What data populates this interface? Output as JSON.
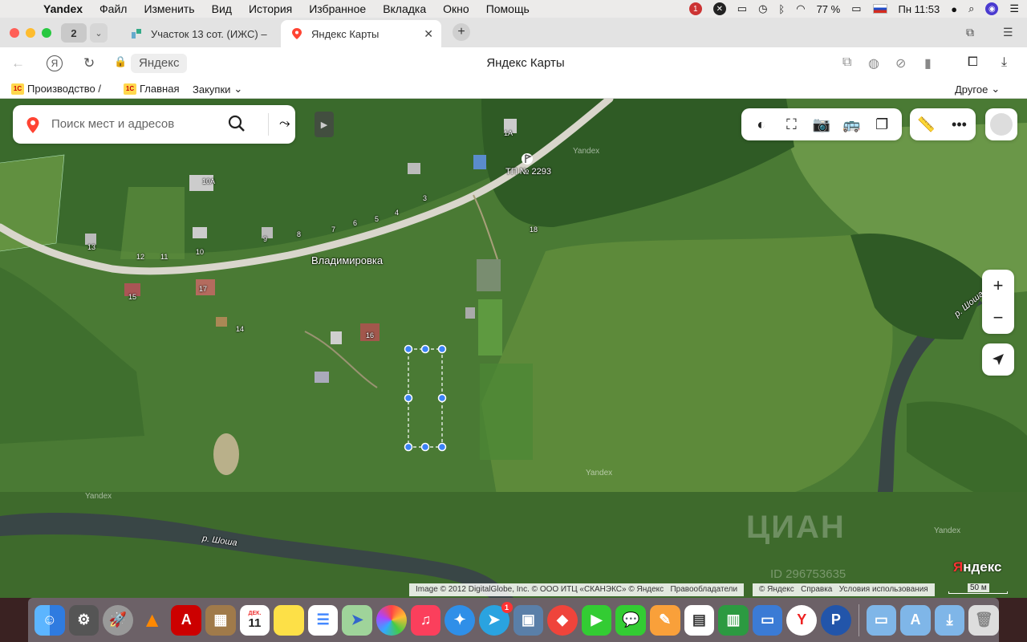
{
  "menubar": {
    "app_name": "Yandex",
    "items": [
      "Файл",
      "Изменить",
      "Вид",
      "История",
      "Избранное",
      "Вкладка",
      "Окно",
      "Помощь"
    ],
    "battery": "77 %",
    "clock": "Пн 11:53"
  },
  "tabs": {
    "count": "2",
    "inactive_title": "Участок 13 сот. (ИЖС) –",
    "active_title": "Яндекс Карты",
    "close": "✕",
    "new": "+"
  },
  "address": {
    "url": "Яндекс",
    "page_title": "Яндекс Карты"
  },
  "bookmarks": {
    "items": [
      {
        "label": "Производство /",
        "icon": "1c-icon"
      },
      {
        "label": "Главная",
        "icon": "1c-icon"
      },
      {
        "label": "Закупки",
        "icon": "none"
      }
    ],
    "other": "Другое"
  },
  "map": {
    "search_placeholder": "Поиск мест и адресов",
    "village": "Владимировка",
    "substation": "ТП № 2293",
    "river1": "р. Шоша",
    "river2": "р. Шоша",
    "house_numbers": [
      "10А",
      "1А",
      "3",
      "5",
      "4",
      "6",
      "7",
      "8",
      "9",
      "10",
      "11",
      "12",
      "13",
      "14",
      "15",
      "16",
      "18",
      "17"
    ],
    "watermark": "Yandex",
    "attribution": "Image © 2012 DigitalGlobe, Inc. © ООО ИТЦ «СКАНЭКС» © Яндекс",
    "rights_holders": "Правообладатели",
    "attribution2_copy": "© Яндекс",
    "help": "Справка",
    "terms": "Условия использования",
    "logo_red": "Я",
    "logo_rest": "ндекс",
    "scale": "50 м",
    "cian": "ЦИАН",
    "cian_id": "ID 296753635",
    "zoom_in": "+",
    "zoom_out": "−"
  },
  "colors": {
    "field_light": "#6e9a3f",
    "field_dark": "#3f6b2b",
    "river": "#3a4a4a",
    "road": "#d9d6cc",
    "marker": "#3b82f6",
    "yandex_red": "#f33"
  },
  "dock": {
    "apps": [
      "finder-icon",
      "preferences-icon",
      "launchpad-icon",
      "vlc-icon",
      "acrobat-icon",
      "notes-icon",
      "calendar-icon",
      "stickies-icon",
      "reminders-icon",
      "maps-icon",
      "photos-icon",
      "music-icon",
      "safari-icon",
      "telegram-icon",
      "preview-icon",
      "anydesk-icon",
      "facetime-icon",
      "messages-icon",
      "pages-icon",
      "numbers-icon",
      "keynote-icon",
      "yandex-browser-icon",
      "p-app-icon",
      "folder-icon",
      "apps-folder-icon",
      "downloads-icon",
      "trash-icon"
    ],
    "calendar_month": "ДЕК.",
    "calendar_day": "11",
    "telegram_badge": "1"
  }
}
